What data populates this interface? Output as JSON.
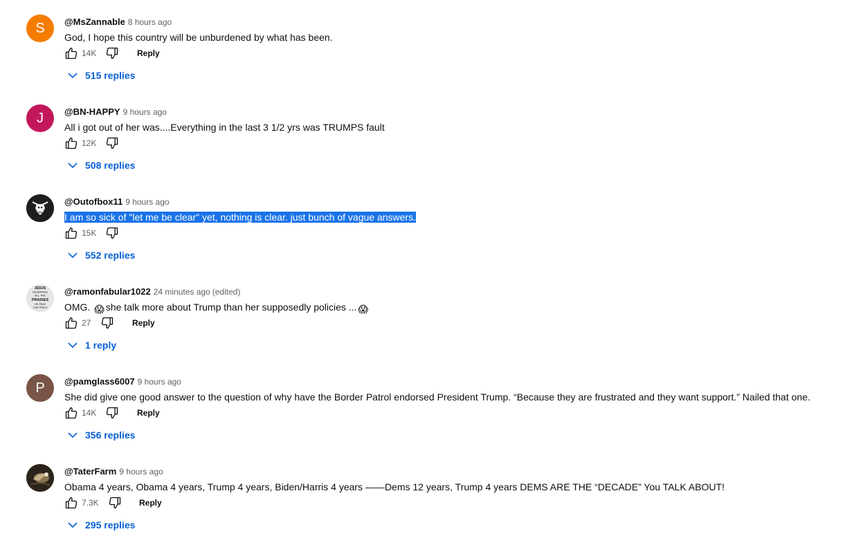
{
  "colors": {
    "link_blue": "#065fd4",
    "muted": "#606060",
    "selection": "#1a73e8"
  },
  "comments": [
    {
      "author": "@MsZannable",
      "time": "8 hours ago",
      "text": "God, I hope this country will be unburdened by what has been.",
      "likes": "14K",
      "reply_label": "Reply",
      "replies": "515 replies",
      "avatar": {
        "letter": "S",
        "color": "#f57c00"
      }
    },
    {
      "author": "@BN-HAPPY",
      "time": "9 hours ago",
      "text": "All i got out of her was....Everything in the last 3 1/2 yrs was TRUMPS fault",
      "likes": "12K",
      "replies": "508 replies",
      "avatar": {
        "letter": "J",
        "color": "#c2185b"
      }
    },
    {
      "author": "@Outofbox11",
      "time": "9 hours ago",
      "text": "I am so sick of \"let me be clear\" yet, nothing is clear.  just bunch of vague answers.",
      "likes": "15K",
      "replies": "552 replies",
      "avatar": {
        "icon": "bull-logo-avatar-icon"
      }
    },
    {
      "author": "@ramonfabular1022",
      "time": "24 minutes ago",
      "edited": "(edited)",
      "text_start": "OMG. ",
      "text_mid": "she talk more about Trump than her supposedly policies ...",
      "emoji": "😱",
      "likes": "27",
      "reply_label": "Reply",
      "replies": "1 reply",
      "avatar": {
        "icon": "jesus-praises-badge-avatar-icon",
        "badge_lines": [
          "JESUS",
          "DESERVES",
          "ALL THE",
          "PRAISES",
          "HE PAID",
          "THE PRICE"
        ]
      }
    },
    {
      "author": "@pamglass6007",
      "time": "9 hours ago",
      "text": "She did give one good answer to the question of why have the Border Patrol endorsed President Trump. “Because they are frustrated and they want support.” Nailed that one.",
      "likes": "14K",
      "reply_label": "Reply",
      "replies": "356 replies",
      "avatar": {
        "letter": "P",
        "color": "#795548"
      }
    },
    {
      "author": "@TaterFarm",
      "time": "9 hours ago",
      "text": "Obama 4 years, Obama 4 years, Trump 4 years, Biden/Harris 4 years ——Dems 12 years, Trump 4 years DEMS ARE THE “DECADE” You TALK ABOUT!",
      "likes": "7.3K",
      "reply_label": "Reply",
      "replies": "295 replies",
      "avatar": {
        "icon": "eagle-photo-avatar-icon"
      }
    }
  ]
}
